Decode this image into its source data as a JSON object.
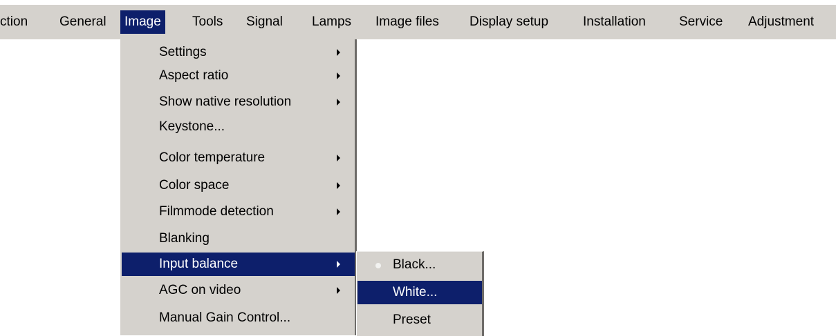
{
  "menubar": {
    "items": [
      {
        "label": "ction"
      },
      {
        "label": "General"
      },
      {
        "label": "Image"
      },
      {
        "label": "Tools"
      },
      {
        "label": "Signal"
      },
      {
        "label": "Lamps"
      },
      {
        "label": "Image files"
      },
      {
        "label": "Display setup"
      },
      {
        "label": "Installation"
      },
      {
        "label": "Service"
      },
      {
        "label": "Adjustment"
      }
    ],
    "active_item": "Image"
  },
  "image_menu": {
    "items": [
      {
        "label": "Settings",
        "has_submenu": true
      },
      {
        "label": "Aspect ratio",
        "has_submenu": true
      },
      {
        "label": "Show native resolution",
        "has_submenu": true
      },
      {
        "label": "Keystone...",
        "has_submenu": false
      },
      {
        "label": "Color temperature",
        "has_submenu": true
      },
      {
        "label": "Color space",
        "has_submenu": true
      },
      {
        "label": "Filmmode detection",
        "has_submenu": true
      },
      {
        "label": "Blanking",
        "has_submenu": false
      },
      {
        "label": "Input balance",
        "has_submenu": true
      },
      {
        "label": "AGC on video",
        "has_submenu": true
      },
      {
        "label": "Manual Gain Control...",
        "has_submenu": false
      }
    ],
    "highlighted_item": "Input balance"
  },
  "input_balance_submenu": {
    "items": [
      {
        "label": "Black...",
        "selected_marker": true
      },
      {
        "label": "White...",
        "selected_marker": false
      },
      {
        "label": "Preset",
        "selected_marker": false
      }
    ],
    "highlighted_item": "White..."
  },
  "colors": {
    "menu_background": "#d5d2cd",
    "highlight_background": "#0d1f6b",
    "highlight_text": "#ffffff",
    "menu_shadow": "#6e6c69"
  }
}
